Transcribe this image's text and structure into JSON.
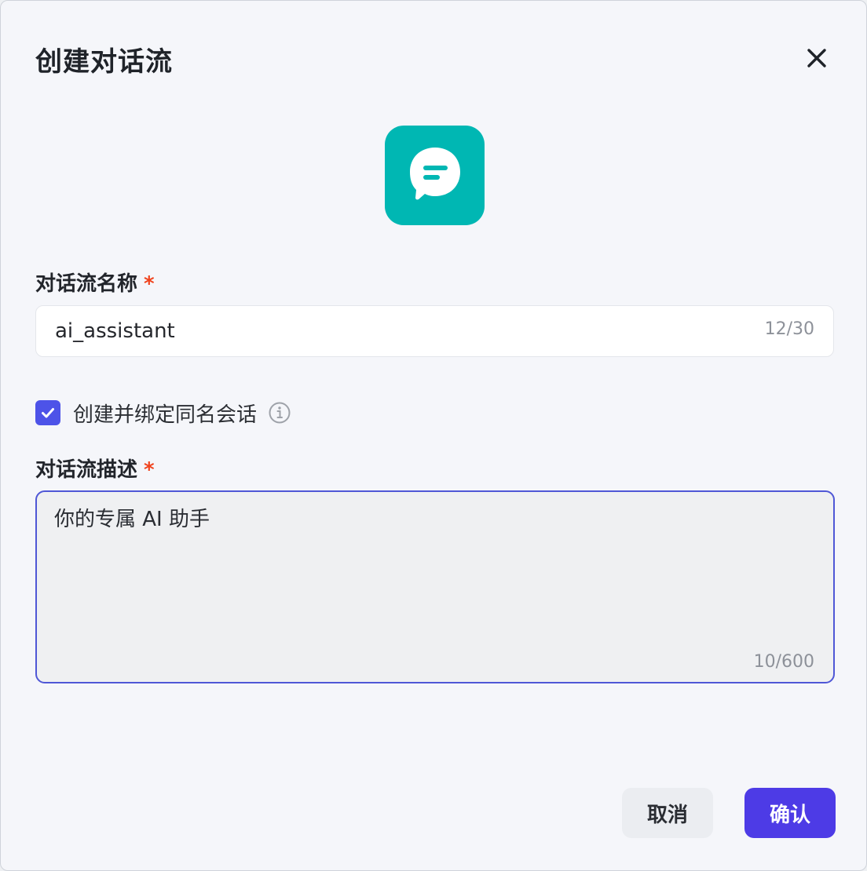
{
  "dialog": {
    "title": "创建对话流",
    "close_icon": "close-icon",
    "app_icon": "chat-bubble-icon",
    "accent_color": "#00b7b3"
  },
  "name_field": {
    "label": "对话流名称",
    "required_mark": "*",
    "value": "ai_assistant",
    "counter": "12/30"
  },
  "bind_conversation": {
    "checked": true,
    "label": "创建并绑定同名会话",
    "info_icon": "info-icon"
  },
  "description_field": {
    "label": "对话流描述",
    "required_mark": "*",
    "value": "你的专属 AI 助手",
    "counter": "10/600"
  },
  "actions": {
    "cancel_label": "取消",
    "confirm_label": "确认",
    "primary_color": "#4d3be6"
  }
}
